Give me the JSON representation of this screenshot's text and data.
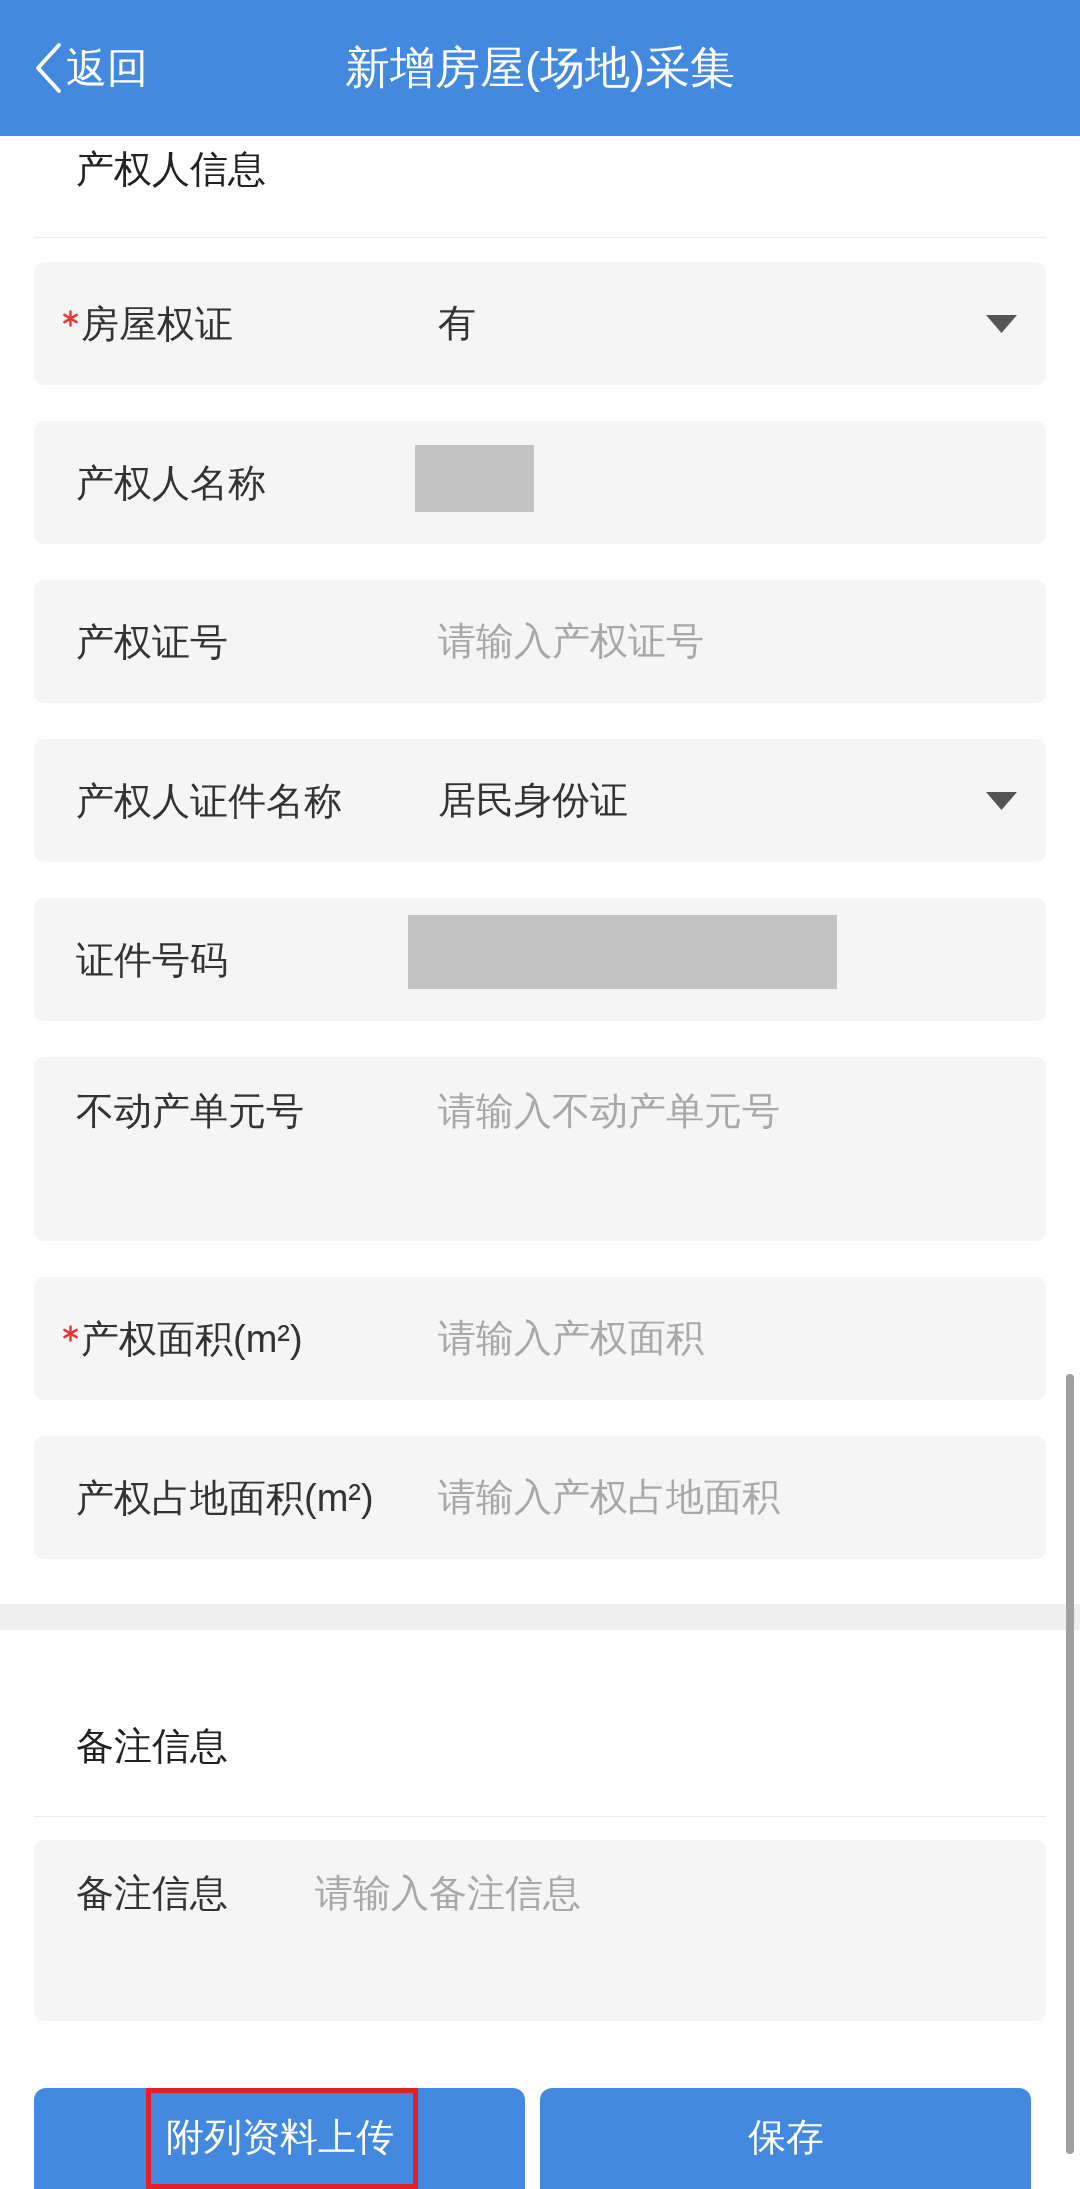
{
  "header": {
    "back_label": "返回",
    "title": "新增房屋(场地)采集"
  },
  "owner_section": {
    "title": "产权人信息",
    "rows": [
      {
        "kind": "select",
        "label": "房屋权证",
        "required": true,
        "value": "有"
      },
      {
        "kind": "masked",
        "label": "产权人名称",
        "required": false
      },
      {
        "kind": "input",
        "label": "产权证号",
        "required": false,
        "placeholder": "请输入产权证号"
      },
      {
        "kind": "select",
        "label": "产权人证件名称",
        "required": false,
        "value": "居民身份证"
      },
      {
        "kind": "masked",
        "label": "证件号码",
        "required": false
      },
      {
        "kind": "textarea",
        "label": "不动产单元号",
        "required": false,
        "placeholder": "请输入不动产单元号"
      },
      {
        "kind": "input",
        "label": "产权面积(m²)",
        "required": true,
        "placeholder": "请输入产权面积"
      },
      {
        "kind": "input",
        "label": "产权占地面积(m²)",
        "required": false,
        "placeholder": "请输入产权占地面积"
      }
    ]
  },
  "remarks_section": {
    "title": "备注信息",
    "field": {
      "label": "备注信息",
      "placeholder": "请输入备注信息"
    }
  },
  "buttons": [
    {
      "label": "附列资料上传",
      "highlighted": true
    },
    {
      "label": "保存",
      "highlighted": false
    }
  ]
}
